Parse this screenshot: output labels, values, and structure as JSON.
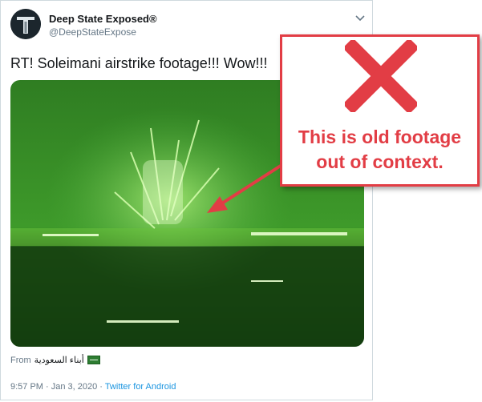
{
  "tweet": {
    "display_name": "Deep State Exposed®",
    "handle": "@DeepStateExpose",
    "text": "RT! Soleimani airstrike footage!!! Wow!!!",
    "source_prefix": "From",
    "source_name": "أبناء السعودية",
    "timestamp": "9:57 PM · Jan 3, 2020 · ",
    "client": "Twitter for Android"
  },
  "annotation": {
    "line1": "This is old footage",
    "line2": "out of context.",
    "color": "#e23d45"
  },
  "colors": {
    "video_green": "#1f6b1a",
    "link_blue": "#1b95e0"
  },
  "icons": [
    "avatar-logo",
    "chevron-down-icon",
    "saudi-flag-icon",
    "x-mark-icon",
    "arrow-icon"
  ]
}
